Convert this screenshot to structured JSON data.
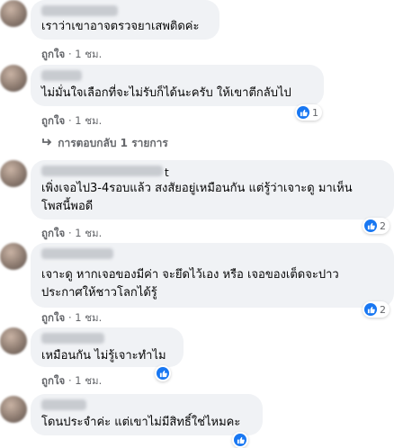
{
  "comments": [
    {
      "text_lines": [
        "เราว่าเขาอาจตรวจยาเสพติดค่ะ"
      ],
      "like_label": "ถูกใจ",
      "time": "1 ชม.",
      "reactions": ""
    },
    {
      "text_lines": [
        "ไม่มั่นใจเลือกที่จะไม่รับก็ได้นะครับ ให้เขาตีกลับไป"
      ],
      "like_label": "ถูกใจ",
      "time": "1 ชม.",
      "reactions": "1"
    },
    {
      "text_lines": [
        "เพิ่งเจอไป3-4รอบแล้ว สงสัยอยู่เหมือนกัน แต่รู้ว่าเจาะดู มาเห็น",
        "โพสนี้พอดี"
      ],
      "like_label": "ถูกใจ",
      "time": "1 ชม.",
      "reactions": "2",
      "name_suffix": "t"
    },
    {
      "text_lines": [
        "เจาะดู หากเจอของมีค่า จะยึดไว้เอง หรือ เจอของเต็ดจะปาว",
        "ประกาศให้ชาวโลกได้รู้"
      ],
      "like_label": "ถูกใจ",
      "time": "1 ชม.",
      "reactions": "2"
    },
    {
      "text_lines": [
        "เหมือนกัน ไม่รู้เจาะทำไม"
      ],
      "like_label": "ถูกใจ",
      "time": "1 ชม.",
      "reactions": ""
    },
    {
      "text_lines": [
        "โดนประจำค่ะ แต่เขาไม่มีสิทธิ์ใช่ไหมคะ"
      ],
      "like_label": "",
      "time": "",
      "reactions": ""
    }
  ],
  "replies_link": "การตอบกลับ 1 รายการ",
  "separator": "·",
  "colors": {
    "accent": "#1877f2",
    "bubble": "#f0f2f5",
    "meta": "#65676b"
  }
}
